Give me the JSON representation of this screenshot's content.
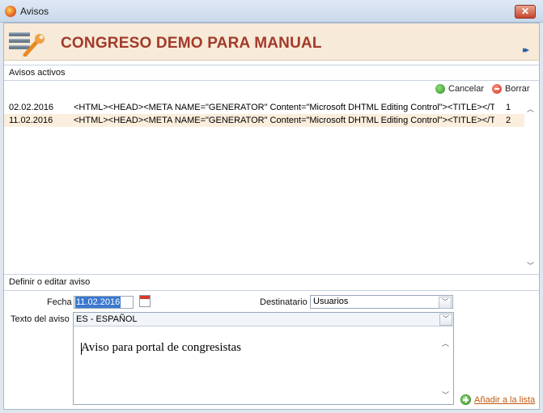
{
  "window": {
    "title": "Avisos",
    "close_label": "✕"
  },
  "header": {
    "title": "CONGRESO DEMO PARA MANUAL",
    "expand_glyph": "▸▸"
  },
  "active_section": {
    "label": "Avisos activos",
    "toolbar": {
      "cancel_label": "Cancelar",
      "delete_label": "Borrar"
    },
    "rows": [
      {
        "date": "02.02.2016",
        "content": "<HTML><HEAD><META NAME=\"GENERATOR\" Content=\"Microsoft DHTML Editing Control\"><TITLE></TITL",
        "num": "1"
      },
      {
        "date": "11.02.2016",
        "content": "<HTML><HEAD><META NAME=\"GENERATOR\" Content=\"Microsoft DHTML Editing Control\"><TITLE></TITL",
        "num": "2"
      }
    ]
  },
  "define_section": {
    "label": "Definir o editar aviso",
    "fecha_label": "Fecha",
    "fecha_value": "11.02.2016",
    "destinatario_label": "Destinatario",
    "destinatario_value": "Usuarios",
    "texto_label": "Texto del aviso",
    "language_value": "ES - ESPAÑOL",
    "editor_text": "Aviso para portal de congresistas",
    "add_label": "Añadir a la lista"
  },
  "icons": [
    "app-icon",
    "close-icon",
    "tools-icon",
    "expand-icon",
    "cancel-icon",
    "delete-icon",
    "calendar-icon",
    "chevron-down-icon",
    "add-icon"
  ],
  "colors": {
    "header_bg": "#f7ead8",
    "title_red": "#a33a2a",
    "selection": "#fbeedd",
    "link_orange": "#c05a10"
  }
}
